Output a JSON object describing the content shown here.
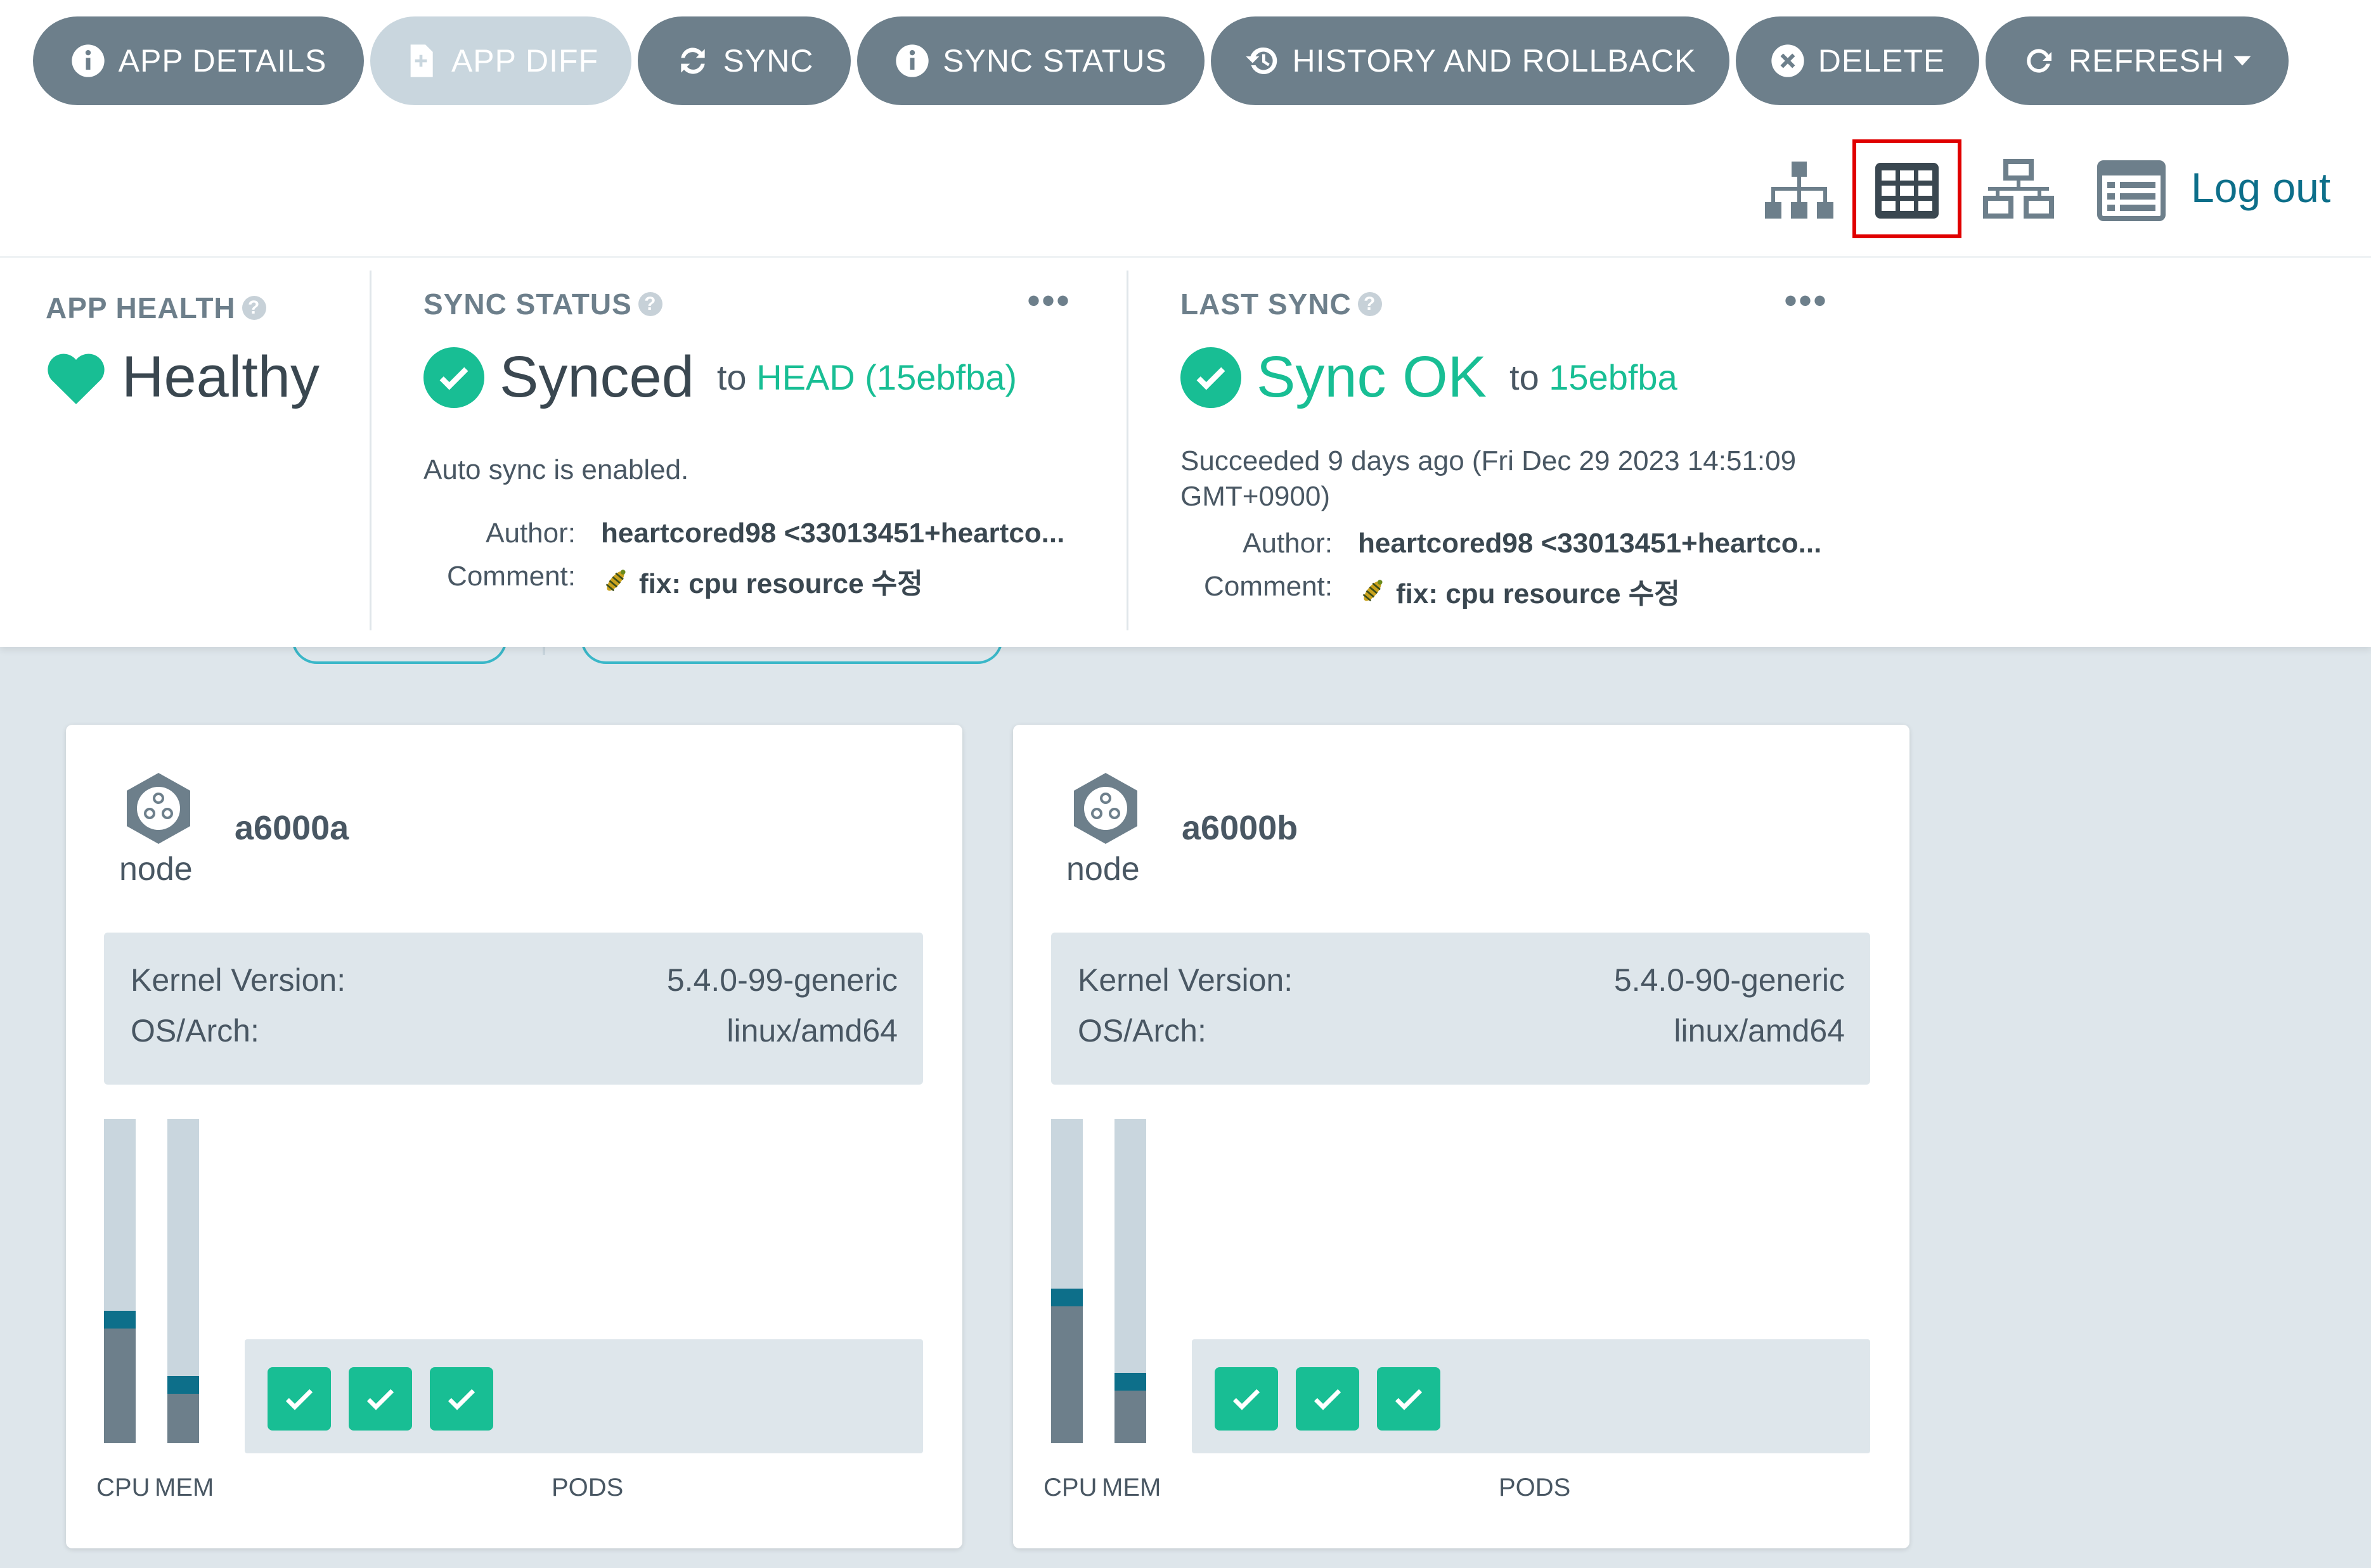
{
  "toolbar": {
    "buttons": [
      {
        "label": "APP DETAILS",
        "icon": "info-icon"
      },
      {
        "label": "APP DIFF",
        "icon": "file-diff-icon"
      },
      {
        "label": "SYNC",
        "icon": "sync-icon"
      },
      {
        "label": "SYNC STATUS",
        "icon": "info-icon"
      },
      {
        "label": "HISTORY AND ROLLBACK",
        "icon": "history-icon"
      },
      {
        "label": "DELETE",
        "icon": "close-circle-icon"
      },
      {
        "label": "REFRESH",
        "icon": "refresh-icon"
      }
    ]
  },
  "views": {
    "active": "grid",
    "items": [
      "tree-view-icon",
      "grid-view-icon",
      "network-view-icon",
      "list-view-icon"
    ],
    "logout_label": "Log out"
  },
  "status": {
    "app_health": {
      "title": "APP HEALTH",
      "value": "Healthy"
    },
    "sync_status": {
      "title": "SYNC STATUS",
      "value": "Synced",
      "to_prefix": "to",
      "target": "HEAD (15ebfba)",
      "auto_sync": "Auto sync is enabled.",
      "author_label": "Author:",
      "author": "heartcored98 <33013451+heartco...",
      "comment_label": "Comment:",
      "comment": "fix: cpu resource 수정"
    },
    "last_sync": {
      "title": "LAST SYNC",
      "value": "Sync OK",
      "to_prefix": "to",
      "target": "15ebfba",
      "succeeded_line1": "Succeeded 9 days ago (Fri Dec 29 2023 14:51:09",
      "succeeded_line2": "GMT+0900)",
      "author_label": "Author:",
      "author": "heartcored98 <33013451+heartco...",
      "comment_label": "Comment:",
      "comment": "fix: cpu resource 수정"
    }
  },
  "colors": {
    "healthy": "#18be94",
    "accent_link": "#0d6f8a",
    "button_bg": "#6d7f8b",
    "highlight": "#e00000"
  },
  "nodes": [
    {
      "name": "a6000a",
      "kind": "node",
      "kernel_label": "Kernel Version:",
      "kernel": "5.4.0-99-generic",
      "os_label": "OS/Arch:",
      "os": "linux/amd64",
      "cpu_fraction": 0.38,
      "mem_fraction": 0.18,
      "pods": 3,
      "cpu_label": "CPU",
      "mem_label": "MEM",
      "pods_label": "PODS"
    },
    {
      "name": "a6000b",
      "kind": "node",
      "kernel_label": "Kernel Version:",
      "kernel": "5.4.0-90-generic",
      "os_label": "OS/Arch:",
      "os": "linux/amd64",
      "cpu_fraction": 0.45,
      "mem_fraction": 0.19,
      "pods": 3,
      "cpu_label": "CPU",
      "mem_label": "MEM",
      "pods_label": "PODS"
    }
  ]
}
